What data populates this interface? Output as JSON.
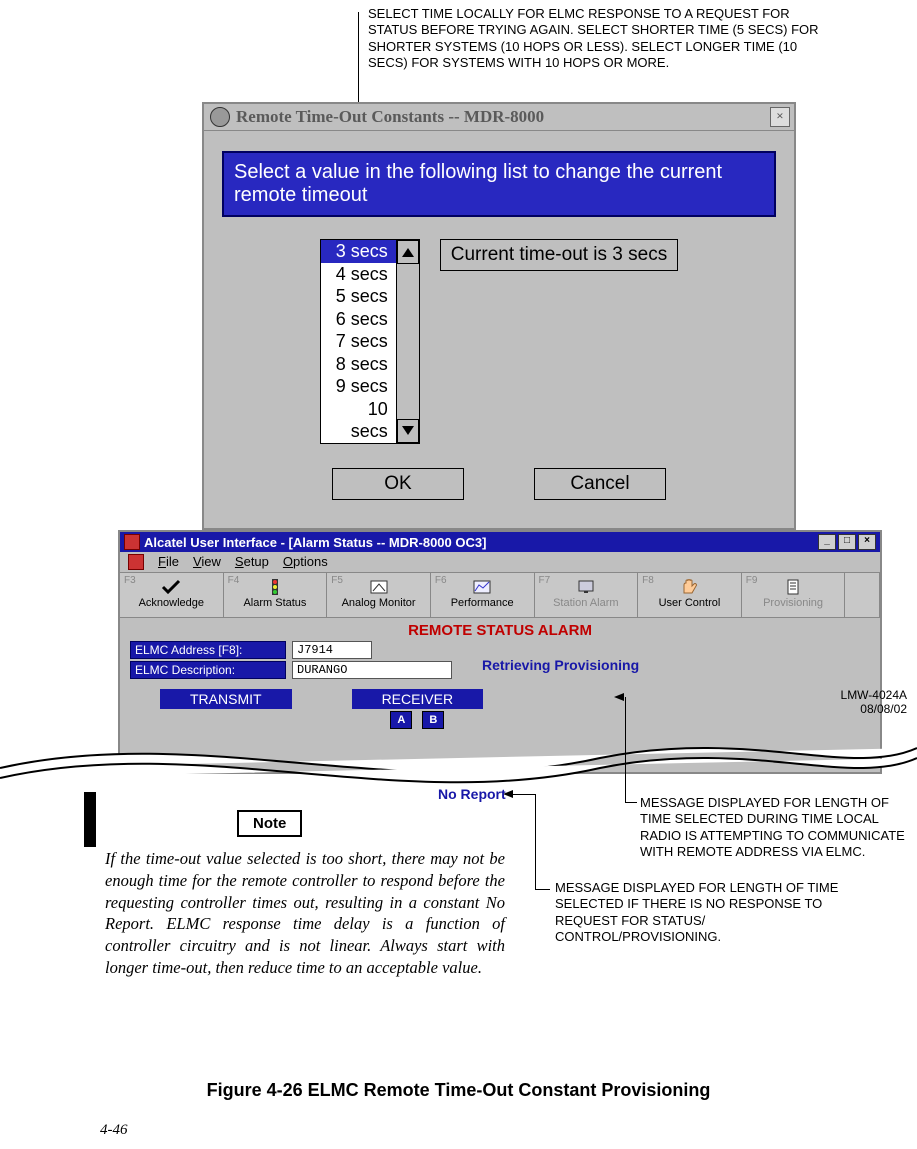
{
  "annot_top": "SELECT TIME LOCALLY FOR ELMC RESPONSE TO A REQUEST FOR STATUS BEFORE TRYING AGAIN. SELECT SHORTER TIME (5 SECS) FOR SHORTER SYSTEMS (10 HOPS OR LESS). SELECT LONGER TIME (10 SECS) FOR SYSTEMS WITH 10 HOPS OR MORE.",
  "dialog": {
    "title": "Remote Time-Out Constants  --  MDR-8000",
    "instruction": "Select a value in the following list to change the current remote timeout",
    "items": [
      "3 secs",
      "4 secs",
      "5 secs",
      "6 secs",
      "7 secs",
      "8 secs",
      "9 secs",
      "10 secs"
    ],
    "selected_index": 0,
    "current": "Current time-out is 3 secs",
    "ok": "OK",
    "cancel": "Cancel"
  },
  "app": {
    "title": "Alcatel User Interface - [Alarm Status -- MDR-8000 OC3]",
    "menu": {
      "file": "File",
      "view": "View",
      "setup": "Setup",
      "options": "Options"
    },
    "toolbar": [
      {
        "fkey": "F3",
        "label": "Acknowledge"
      },
      {
        "fkey": "F4",
        "label": "Alarm Status"
      },
      {
        "fkey": "F5",
        "label": "Analog Monitor"
      },
      {
        "fkey": "F6",
        "label": "Performance"
      },
      {
        "fkey": "F7",
        "label": "Station Alarm"
      },
      {
        "fkey": "F8",
        "label": "User Control"
      },
      {
        "fkey": "F9",
        "label": "Provisioning"
      }
    ],
    "remote_status": "REMOTE STATUS ALARM",
    "elmc_addr_label": "ELMC Address [F8]:",
    "elmc_addr_value": "J7914",
    "elmc_desc_label": "ELMC Description:",
    "elmc_desc_value": "DURANGO",
    "retrieving": "Retrieving Provisioning",
    "transmit": "TRANSMIT",
    "receiver": "RECEIVER",
    "a": "A",
    "b": "B"
  },
  "no_report": "No Report",
  "annot_right_1": "MESSAGE DISPLAYED FOR LENGTH OF TIME SELECTED DURING TIME LOCAL RADIO IS ATTEMPTING TO COMMUNICATE WITH REMOTE ADDRESS VIA ELMC.",
  "annot_right_2": "MESSAGE DISPLAYED FOR LENGTH OF TIME SELECTED IF THERE IS NO RESPONSE TO REQUEST FOR STATUS/ CONTROL/PROVISIONING.",
  "lmw": {
    "l1": "LMW-4024A",
    "l2": "08/08/02"
  },
  "note_label": "Note",
  "note_body": "If the time-out value selected is too short, there may not be enough time for the remote controller to respond before the requesting controller times out, resulting in a constant No Report. ELMC response time delay is a function of controller circuitry and is not linear. Always start with longer time-out, then reduce time to an acceptable value.",
  "figure_caption": "Figure 4-26  ELMC Remote Time-Out Constant Provisioning",
  "pagenum": "4-46"
}
